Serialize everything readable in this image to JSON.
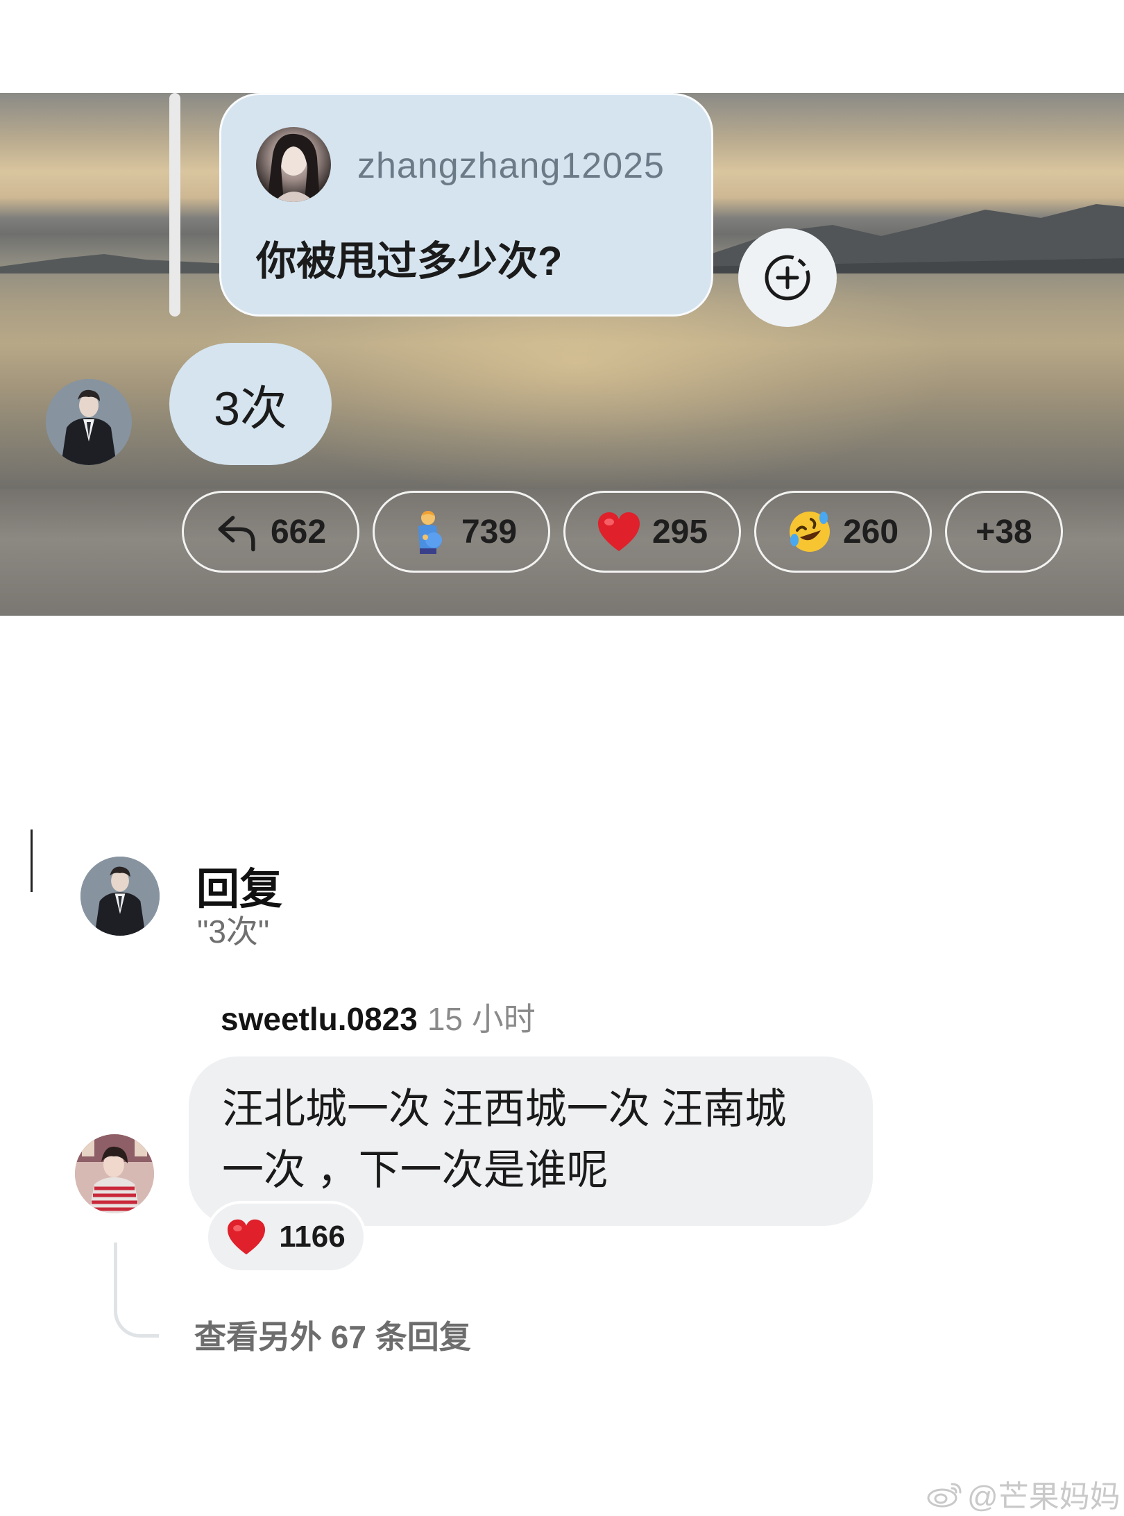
{
  "top_panel": {
    "quote": {
      "username": "zhangzhang12025",
      "question": "你被甩过多少次?"
    },
    "answer_text": "3次",
    "reactions": [
      {
        "icon": "reply-arrow-icon",
        "count": "662"
      },
      {
        "icon": "pregnant-man-emoji",
        "count": "739"
      },
      {
        "icon": "red-heart-emoji",
        "count": "295"
      },
      {
        "icon": "rolling-laughing-emoji",
        "count": "260"
      }
    ],
    "more_reactions": "+38"
  },
  "reply_header": {
    "title": "回复",
    "quoted": "\"3次\""
  },
  "comment": {
    "username": "sweetlu.0823",
    "time": "15 小时",
    "text_line1": "汪北城一次 汪西城一次 汪南城",
    "text_line2": "一次 ，下一次是谁呢",
    "like_count": "1166"
  },
  "view_more": "查看另外 67 条回复",
  "watermark": "@芒果妈妈",
  "colors": {
    "bubble_blue": "#d5e4ef",
    "bubble_grey": "#eef0f2",
    "heart_red": "#e0202a"
  }
}
